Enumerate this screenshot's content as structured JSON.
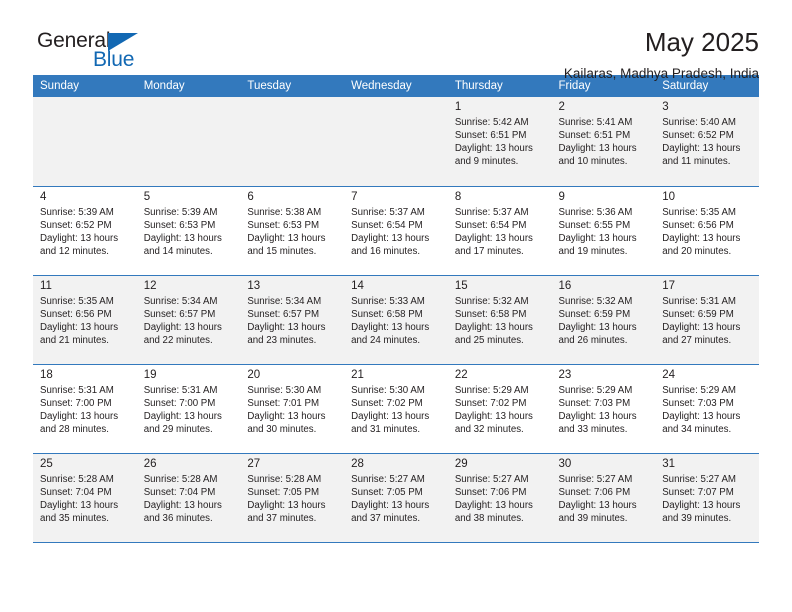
{
  "brand": {
    "name_top": "General",
    "name_bottom": "Blue",
    "triangle_color": "#1268b3",
    "text_color": "#231f20"
  },
  "header": {
    "month_title": "May 2025",
    "location": "Kailaras, Madhya Pradesh, India"
  },
  "theme": {
    "header_row_bg": "#3379bd",
    "header_row_text": "#ffffff",
    "row_shade_bg": "#f2f2f2",
    "grid_line": "#3379bd",
    "body_text": "#231f20"
  },
  "calendar": {
    "columns": [
      "Sunday",
      "Monday",
      "Tuesday",
      "Wednesday",
      "Thursday",
      "Friday",
      "Saturday"
    ],
    "weeks": [
      {
        "shaded": true,
        "days": [
          {
            "day": "",
            "detail": ""
          },
          {
            "day": "",
            "detail": ""
          },
          {
            "day": "",
            "detail": ""
          },
          {
            "day": "",
            "detail": ""
          },
          {
            "day": "1",
            "detail": "Sunrise: 5:42 AM\nSunset: 6:51 PM\nDaylight: 13 hours\nand 9 minutes."
          },
          {
            "day": "2",
            "detail": "Sunrise: 5:41 AM\nSunset: 6:51 PM\nDaylight: 13 hours\nand 10 minutes."
          },
          {
            "day": "3",
            "detail": "Sunrise: 5:40 AM\nSunset: 6:52 PM\nDaylight: 13 hours\nand 11 minutes."
          }
        ]
      },
      {
        "shaded": false,
        "days": [
          {
            "day": "4",
            "detail": "Sunrise: 5:39 AM\nSunset: 6:52 PM\nDaylight: 13 hours\nand 12 minutes."
          },
          {
            "day": "5",
            "detail": "Sunrise: 5:39 AM\nSunset: 6:53 PM\nDaylight: 13 hours\nand 14 minutes."
          },
          {
            "day": "6",
            "detail": "Sunrise: 5:38 AM\nSunset: 6:53 PM\nDaylight: 13 hours\nand 15 minutes."
          },
          {
            "day": "7",
            "detail": "Sunrise: 5:37 AM\nSunset: 6:54 PM\nDaylight: 13 hours\nand 16 minutes."
          },
          {
            "day": "8",
            "detail": "Sunrise: 5:37 AM\nSunset: 6:54 PM\nDaylight: 13 hours\nand 17 minutes."
          },
          {
            "day": "9",
            "detail": "Sunrise: 5:36 AM\nSunset: 6:55 PM\nDaylight: 13 hours\nand 19 minutes."
          },
          {
            "day": "10",
            "detail": "Sunrise: 5:35 AM\nSunset: 6:56 PM\nDaylight: 13 hours\nand 20 minutes."
          }
        ]
      },
      {
        "shaded": true,
        "days": [
          {
            "day": "11",
            "detail": "Sunrise: 5:35 AM\nSunset: 6:56 PM\nDaylight: 13 hours\nand 21 minutes."
          },
          {
            "day": "12",
            "detail": "Sunrise: 5:34 AM\nSunset: 6:57 PM\nDaylight: 13 hours\nand 22 minutes."
          },
          {
            "day": "13",
            "detail": "Sunrise: 5:34 AM\nSunset: 6:57 PM\nDaylight: 13 hours\nand 23 minutes."
          },
          {
            "day": "14",
            "detail": "Sunrise: 5:33 AM\nSunset: 6:58 PM\nDaylight: 13 hours\nand 24 minutes."
          },
          {
            "day": "15",
            "detail": "Sunrise: 5:32 AM\nSunset: 6:58 PM\nDaylight: 13 hours\nand 25 minutes."
          },
          {
            "day": "16",
            "detail": "Sunrise: 5:32 AM\nSunset: 6:59 PM\nDaylight: 13 hours\nand 26 minutes."
          },
          {
            "day": "17",
            "detail": "Sunrise: 5:31 AM\nSunset: 6:59 PM\nDaylight: 13 hours\nand 27 minutes."
          }
        ]
      },
      {
        "shaded": false,
        "days": [
          {
            "day": "18",
            "detail": "Sunrise: 5:31 AM\nSunset: 7:00 PM\nDaylight: 13 hours\nand 28 minutes."
          },
          {
            "day": "19",
            "detail": "Sunrise: 5:31 AM\nSunset: 7:00 PM\nDaylight: 13 hours\nand 29 minutes."
          },
          {
            "day": "20",
            "detail": "Sunrise: 5:30 AM\nSunset: 7:01 PM\nDaylight: 13 hours\nand 30 minutes."
          },
          {
            "day": "21",
            "detail": "Sunrise: 5:30 AM\nSunset: 7:02 PM\nDaylight: 13 hours\nand 31 minutes."
          },
          {
            "day": "22",
            "detail": "Sunrise: 5:29 AM\nSunset: 7:02 PM\nDaylight: 13 hours\nand 32 minutes."
          },
          {
            "day": "23",
            "detail": "Sunrise: 5:29 AM\nSunset: 7:03 PM\nDaylight: 13 hours\nand 33 minutes."
          },
          {
            "day": "24",
            "detail": "Sunrise: 5:29 AM\nSunset: 7:03 PM\nDaylight: 13 hours\nand 34 minutes."
          }
        ]
      },
      {
        "shaded": true,
        "days": [
          {
            "day": "25",
            "detail": "Sunrise: 5:28 AM\nSunset: 7:04 PM\nDaylight: 13 hours\nand 35 minutes."
          },
          {
            "day": "26",
            "detail": "Sunrise: 5:28 AM\nSunset: 7:04 PM\nDaylight: 13 hours\nand 36 minutes."
          },
          {
            "day": "27",
            "detail": "Sunrise: 5:28 AM\nSunset: 7:05 PM\nDaylight: 13 hours\nand 37 minutes."
          },
          {
            "day": "28",
            "detail": "Sunrise: 5:27 AM\nSunset: 7:05 PM\nDaylight: 13 hours\nand 37 minutes."
          },
          {
            "day": "29",
            "detail": "Sunrise: 5:27 AM\nSunset: 7:06 PM\nDaylight: 13 hours\nand 38 minutes."
          },
          {
            "day": "30",
            "detail": "Sunrise: 5:27 AM\nSunset: 7:06 PM\nDaylight: 13 hours\nand 39 minutes."
          },
          {
            "day": "31",
            "detail": "Sunrise: 5:27 AM\nSunset: 7:07 PM\nDaylight: 13 hours\nand 39 minutes."
          }
        ]
      }
    ]
  }
}
